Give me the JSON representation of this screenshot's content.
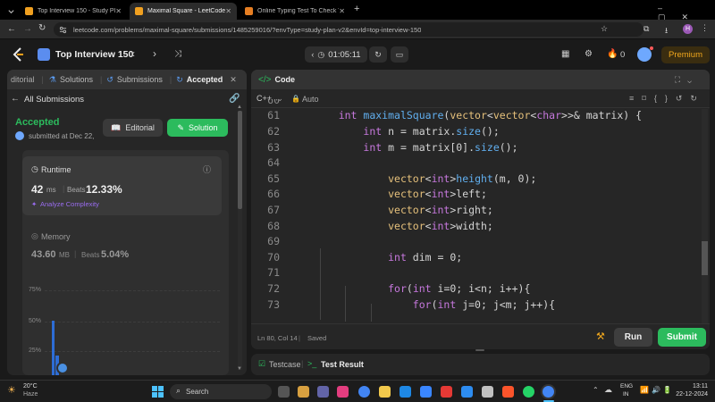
{
  "browser": {
    "tabs": [
      {
        "title": "Top Interview 150 - Study Plan",
        "active": false
      },
      {
        "title": "Maximal Square - LeetCode",
        "active": true
      },
      {
        "title": "Online Typing Test To Check Yo",
        "active": false
      }
    ],
    "url": "leetcode.com/problems/maximal-square/submissions/1485259016/?envType=study-plan-v2&envId=top-interview-150",
    "profile_initial": "H"
  },
  "nav": {
    "study_plan": "Top Interview 150",
    "timer": "01:05:11",
    "notifications": "0",
    "premium": "Premium"
  },
  "left": {
    "tabs": {
      "editorial": "ditorial",
      "solutions": "Solutions",
      "submissions": "Submissions",
      "accepted": "Accepted"
    },
    "back_label": "All Submissions",
    "status": "Accepted",
    "submitted": "submitted at Dec 22,",
    "editorial_btn": "Editorial",
    "solution_btn": "Solution",
    "runtime": {
      "label": "Runtime",
      "value": "42",
      "unit": "ms",
      "beats_label": "Beats",
      "beats": "12.33%",
      "analyze": "Analyze Complexity"
    },
    "memory": {
      "label": "Memory",
      "value": "43.60",
      "unit": "MB",
      "beats_label": "Beats",
      "beats": "5.04%"
    },
    "chart_ticks": [
      "75%",
      "50%",
      "25%"
    ]
  },
  "code": {
    "header": "Code",
    "language": "C++",
    "auto": "Auto",
    "status_pos": "Ln 80, Col 14",
    "status_saved": "Saved",
    "run": "Run",
    "submit": "Submit",
    "lines": [
      {
        "n": "60",
        "indent": 0,
        "parts": []
      },
      {
        "n": "61",
        "indent": 4,
        "parts": [
          [
            "kw",
            "int "
          ],
          [
            "fn",
            "maximalSquare"
          ],
          [
            "tx",
            "("
          ],
          [
            "ty",
            "vector"
          ],
          [
            "tx",
            "<"
          ],
          [
            "ty",
            "vector"
          ],
          [
            "tx",
            "<"
          ],
          [
            "kw",
            "char"
          ],
          [
            "tx",
            ">>& "
          ],
          [
            "tx",
            "matrix) {"
          ]
        ]
      },
      {
        "n": "62",
        "indent": 8,
        "parts": [
          [
            "kw",
            "int "
          ],
          [
            "tx",
            "n = "
          ],
          [
            "tx",
            "matrix."
          ],
          [
            "fn",
            "size"
          ],
          [
            "tx",
            "();"
          ]
        ]
      },
      {
        "n": "63",
        "indent": 8,
        "parts": [
          [
            "kw",
            "int "
          ],
          [
            "tx",
            "m = "
          ],
          [
            "tx",
            "matrix[0]."
          ],
          [
            "fn",
            "size"
          ],
          [
            "tx",
            "();"
          ]
        ]
      },
      {
        "n": "64",
        "indent": 0,
        "parts": []
      },
      {
        "n": "65",
        "indent": 12,
        "parts": [
          [
            "ty",
            "vector"
          ],
          [
            "tx",
            "<"
          ],
          [
            "kw",
            "int"
          ],
          [
            "tx",
            ">"
          ],
          [
            "fn",
            "height"
          ],
          [
            "tx",
            "(m, 0);"
          ]
        ]
      },
      {
        "n": "66",
        "indent": 12,
        "parts": [
          [
            "ty",
            "vector"
          ],
          [
            "tx",
            "<"
          ],
          [
            "kw",
            "int"
          ],
          [
            "tx",
            ">left;"
          ]
        ]
      },
      {
        "n": "67",
        "indent": 12,
        "parts": [
          [
            "ty",
            "vector"
          ],
          [
            "tx",
            "<"
          ],
          [
            "kw",
            "int"
          ],
          [
            "tx",
            ">right;"
          ]
        ]
      },
      {
        "n": "68",
        "indent": 12,
        "parts": [
          [
            "ty",
            "vector"
          ],
          [
            "tx",
            "<"
          ],
          [
            "kw",
            "int"
          ],
          [
            "tx",
            ">width;"
          ]
        ]
      },
      {
        "n": "69",
        "indent": 0,
        "parts": []
      },
      {
        "n": "70",
        "indent": 12,
        "parts": [
          [
            "kw",
            "int "
          ],
          [
            "tx",
            "dim = 0;"
          ]
        ]
      },
      {
        "n": "71",
        "indent": 0,
        "parts": []
      },
      {
        "n": "72",
        "indent": 12,
        "parts": [
          [
            "kw",
            "for"
          ],
          [
            "tx",
            "("
          ],
          [
            "kw",
            "int "
          ],
          [
            "tx",
            "i=0; i<n; i++){"
          ]
        ]
      },
      {
        "n": "73",
        "indent": 16,
        "parts": [
          [
            "kw",
            "for"
          ],
          [
            "tx",
            "("
          ],
          [
            "kw",
            "int "
          ],
          [
            "tx",
            "j=0; j<m; j++){"
          ]
        ]
      }
    ]
  },
  "bottom": {
    "testcase": "Testcase",
    "result": "Test Result"
  },
  "taskbar": {
    "weather_temp": "20°C",
    "weather_desc": "Haze",
    "search": "Search",
    "lang": "ENG",
    "region": "IN",
    "time": "13:11",
    "date": "22-12-2024"
  }
}
